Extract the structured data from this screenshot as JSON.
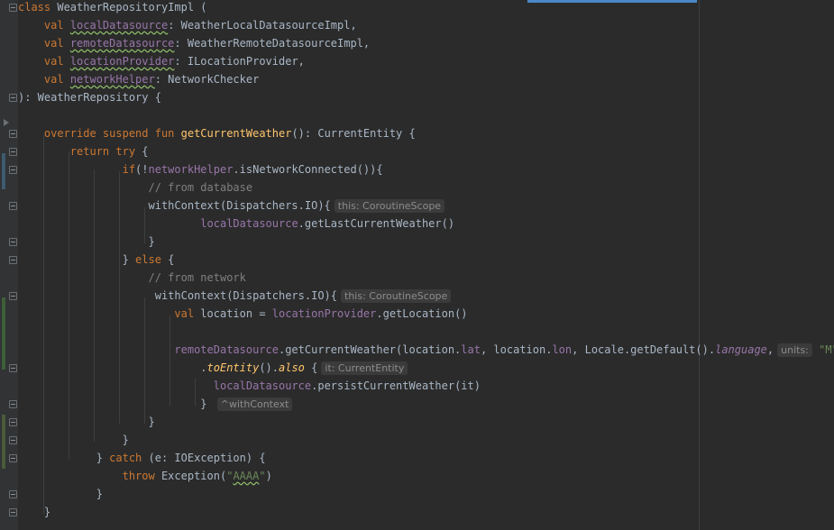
{
  "editor": {
    "language": "Kotlin",
    "theme": "Darcula",
    "lines": [
      [
        {
          "t": "class ",
          "c": "kw"
        },
        {
          "t": "WeatherRepositoryImpl ("
        }
      ],
      [
        {
          "t": "    "
        },
        {
          "t": "val ",
          "c": "kw"
        },
        {
          "t": "localDatasource",
          "c": "prop warn"
        },
        {
          "t": ": WeatherLocalDatasourceImpl,"
        }
      ],
      [
        {
          "t": "    "
        },
        {
          "t": "val ",
          "c": "kw"
        },
        {
          "t": "remoteDatasource",
          "c": "prop warn"
        },
        {
          "t": ": WeatherRemoteDatasourceImpl,"
        }
      ],
      [
        {
          "t": "    "
        },
        {
          "t": "val ",
          "c": "kw"
        },
        {
          "t": "locationProvider",
          "c": "prop warn"
        },
        {
          "t": ": ILocationProvider,"
        }
      ],
      [
        {
          "t": "    "
        },
        {
          "t": "val ",
          "c": "kw"
        },
        {
          "t": "networkHelper",
          "c": "prop warn"
        },
        {
          "t": ": NetworkChecker"
        }
      ],
      [
        {
          "t": "): WeatherRepository {"
        }
      ],
      [],
      [
        {
          "t": "    "
        },
        {
          "t": "override suspend fun ",
          "c": "kw"
        },
        {
          "t": "getCurrentWeather",
          "c": "fn"
        },
        {
          "t": "(): CurrentEntity {"
        }
      ],
      [
        {
          "t": "        "
        },
        {
          "t": "return try ",
          "c": "kw"
        },
        {
          "t": "{"
        }
      ],
      [
        {
          "t": "                "
        },
        {
          "t": "if",
          "c": "kw"
        },
        {
          "t": "(!"
        },
        {
          "t": "networkHelper",
          "c": "prop"
        },
        {
          "t": ".isNetworkConnected()){"
        }
      ],
      [
        {
          "t": "                    "
        },
        {
          "t": "// from database",
          "c": "cmt"
        }
      ],
      [
        {
          "t": "                    withContext(Dispatchers.IO){"
        },
        {
          "t": "this: CoroutineScope",
          "c": "hint"
        }
      ],
      [
        {
          "t": "                            "
        },
        {
          "t": "localDatasource",
          "c": "prop"
        },
        {
          "t": ".getLastCurrentWeather()"
        }
      ],
      [
        {
          "t": "                    }"
        }
      ],
      [
        {
          "t": "                } "
        },
        {
          "t": "else ",
          "c": "kw"
        },
        {
          "t": "{"
        }
      ],
      [
        {
          "t": "                    "
        },
        {
          "t": "// from network",
          "c": "cmt"
        }
      ],
      [
        {
          "t": "                     withContext(Dispatchers.IO){"
        },
        {
          "t": "this: CoroutineScope",
          "c": "hint"
        }
      ],
      [
        {
          "t": "                        "
        },
        {
          "t": "val ",
          "c": "kw"
        },
        {
          "t": "location = "
        },
        {
          "t": "locationProvider",
          "c": "prop"
        },
        {
          "t": ".getLocation()"
        }
      ],
      [],
      [
        {
          "t": "                        "
        },
        {
          "t": "remoteDatasource",
          "c": "prop"
        },
        {
          "t": ".getCurrentWeather(location."
        },
        {
          "t": "lat",
          "c": "prop"
        },
        {
          "t": ", location."
        },
        {
          "t": "lon",
          "c": "prop"
        },
        {
          "t": ", Locale.getDefault()."
        },
        {
          "t": "language",
          "c": "prop ital"
        },
        {
          "t": ","
        },
        {
          "t": "units:",
          "c": "hint"
        },
        {
          "t": " "
        },
        {
          "t": "\"M\"",
          "c": "str"
        },
        {
          "t": ")"
        }
      ],
      [
        {
          "t": "                            ."
        },
        {
          "t": "toEntity",
          "c": "fn ital"
        },
        {
          "t": "()."
        },
        {
          "t": "also",
          "c": "fn ital"
        },
        {
          "t": " {"
        },
        {
          "t": "it: CurrentEntity",
          "c": "hint"
        }
      ],
      [
        {
          "t": "                              "
        },
        {
          "t": "localDatasource",
          "c": "prop"
        },
        {
          "t": ".persistCurrentWeather(it)"
        }
      ],
      [
        {
          "t": "                            } "
        },
        {
          "t": "^withContext",
          "c": "hint"
        }
      ],
      [
        {
          "t": "                    }"
        }
      ],
      [
        {
          "t": "                }"
        }
      ],
      [
        {
          "t": "            } "
        },
        {
          "t": "catch ",
          "c": "kw"
        },
        {
          "t": "(e: IOException) {"
        }
      ],
      [
        {
          "t": "                "
        },
        {
          "t": "throw ",
          "c": "kw"
        },
        {
          "t": "Exception("
        },
        {
          "t": "\"",
          "c": "str"
        },
        {
          "t": "AAAA",
          "c": "str warn"
        },
        {
          "t": "\"",
          "c": "str"
        },
        {
          "t": ")"
        }
      ],
      [
        {
          "t": "            }"
        }
      ],
      [
        {
          "t": "    }"
        }
      ]
    ]
  },
  "colors": {
    "background": "#2b2b2b",
    "gutter": "#313335",
    "keyword": "#cc7832",
    "function": "#ffc66d",
    "property": "#9876aa",
    "string": "#6a8759",
    "comment": "#808080",
    "text": "#a9b7c6",
    "scroll_indicator": "#4a88c7"
  },
  "gutter_icons": [
    "fold-icon",
    "run-icon"
  ]
}
